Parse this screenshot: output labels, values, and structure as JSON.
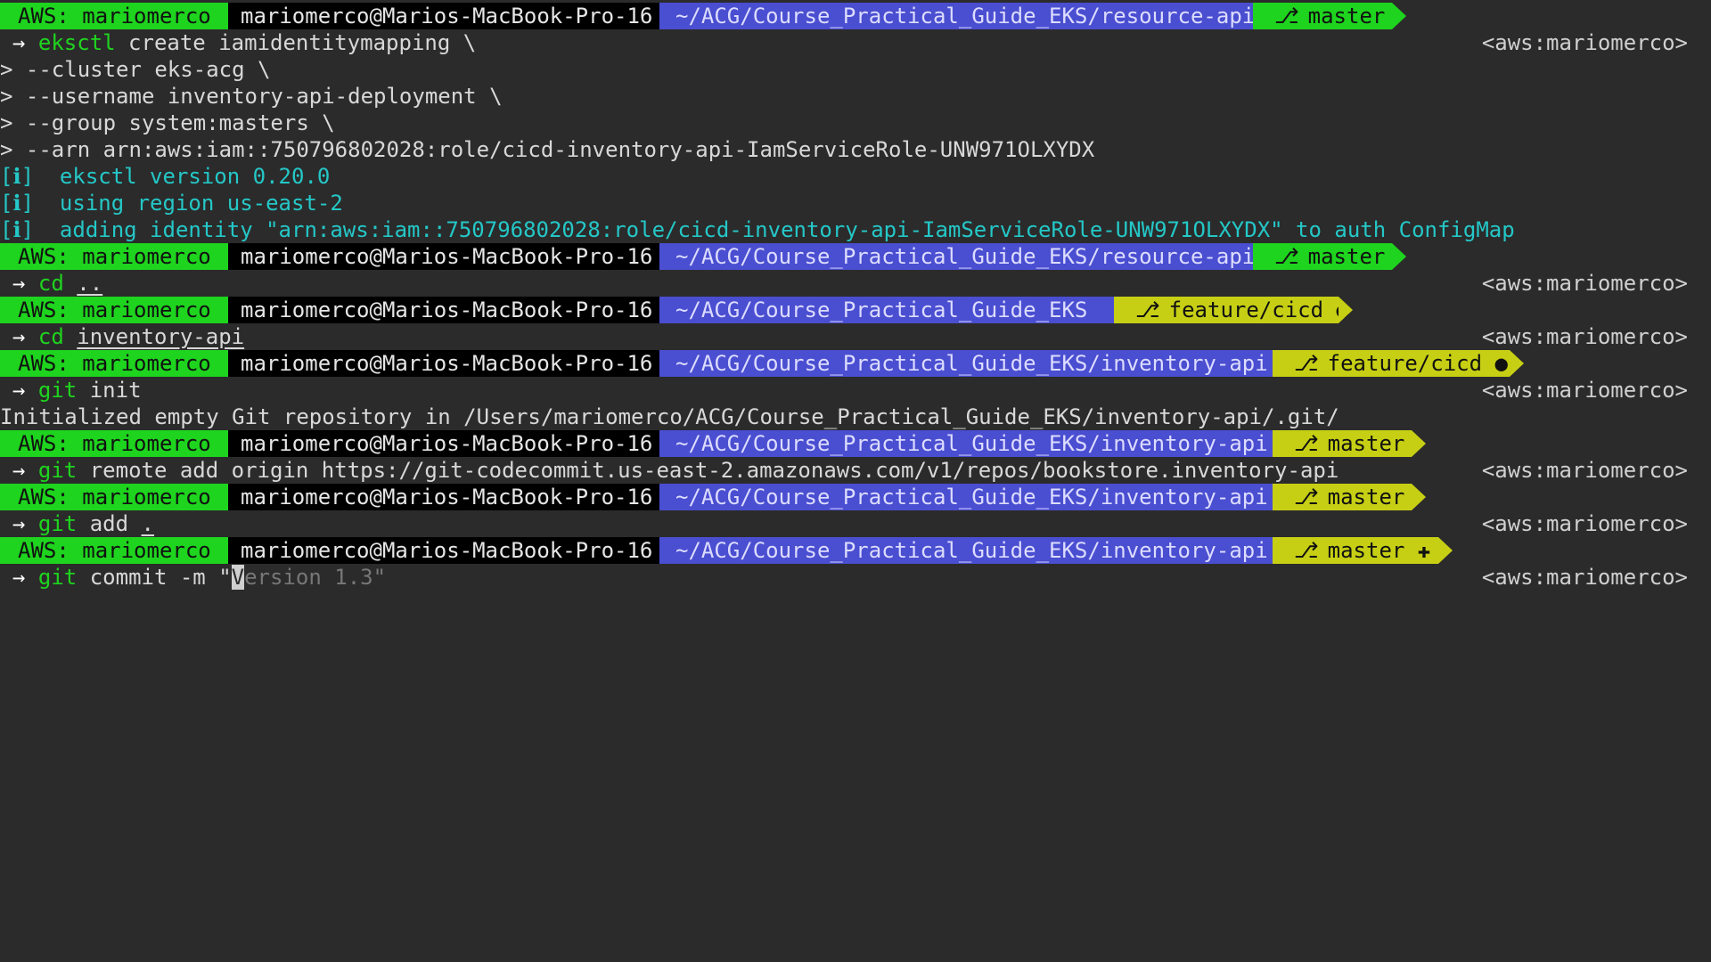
{
  "prompt": {
    "aws": "AWS: mariomerco",
    "host": "mariomerco@Marios-MacBook-Pro-16",
    "right": "<aws:mariomerco>",
    "arrow": "→",
    "branch_icon": "branch-icon",
    "colors": {
      "aws": "#1ed41e",
      "host": "#000000",
      "path": "#4a4ed0",
      "git_clean": "#1ed41e",
      "git_dirty": "#c6cf14",
      "info": "#25c7c7",
      "background": "#2b2b2b"
    }
  },
  "paths": {
    "resource_api": "~/ACG/Course_Practical_Guide_EKS/resource-api",
    "root": "~/ACG/Course_Practical_Guide_EKS",
    "inventory_api": "~/ACG/Course_Practical_Guide_EKS/inventory-api"
  },
  "branches": {
    "master": "master",
    "feature": "feature/cicd ●",
    "master_staged": "master ✚"
  },
  "commands": {
    "c1_cmd": "eksctl",
    "c1_rest": " create iamidentitymapping \\",
    "c1_cont1": "> --cluster eks-acg \\",
    "c1_cont2": "> --username inventory-api-deployment \\",
    "c1_cont3": "> --group system:masters \\",
    "c1_cont4": "> --arn arn:aws:iam::750796802028:role/cicd-inventory-api-IamServiceRole-UNW971OLXYDX",
    "c2_cmd": "cd",
    "c2_arg": "..",
    "c3_cmd": "cd",
    "c3_arg": "inventory-api",
    "c4_cmd": "git",
    "c4_rest": " init",
    "c5_cmd": "git",
    "c5_rest": " remote add origin https://git-codecommit.us-east-2.amazonaws.com/v1/repos/bookstore.inventory-api",
    "c6_cmd": "git",
    "c6_rest": " add ",
    "c6_arg": ".",
    "c7_cmd": "git",
    "c7_rest": " commit -m \"",
    "c7_cursor": "V",
    "c7_suggest": "ersion 1.3\""
  },
  "output": {
    "info_tag": "[ℹ]",
    "info1": "  eksctl version 0.20.0",
    "info2": "  using region us-east-2",
    "info3": "  adding identity \"arn:aws:iam::750796802028:role/cicd-inventory-api-IamServiceRole-UNW971OLXYDX\" to auth ConfigMap",
    "git_init": "Initialized empty Git repository in /Users/mariomerco/ACG/Course_Practical_Guide_EKS/inventory-api/.git/"
  }
}
